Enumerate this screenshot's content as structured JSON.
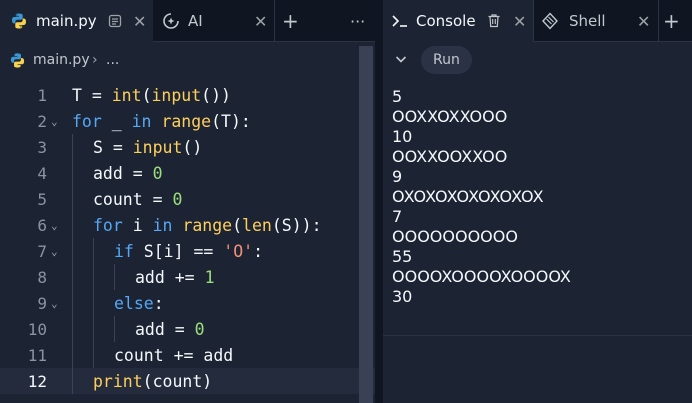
{
  "editor": {
    "tabs": [
      {
        "label": "main.py",
        "icon": "python-icon",
        "active": true
      },
      {
        "label": "AI",
        "icon": "ai-icon",
        "active": false
      }
    ],
    "breadcrumb": {
      "file": "main.py",
      "separator": "›",
      "ellipsis": "..."
    },
    "lines": [
      {
        "n": "1",
        "fold": false,
        "indent": 0,
        "tokens": [
          [
            "id",
            "T "
          ],
          [
            "op",
            "= "
          ],
          [
            "fn",
            "int"
          ],
          [
            "op",
            "("
          ],
          [
            "fn",
            "input"
          ],
          [
            "op",
            "())"
          ]
        ]
      },
      {
        "n": "2",
        "fold": true,
        "indent": 0,
        "tokens": [
          [
            "kw",
            "for"
          ],
          [
            "id",
            " _ "
          ],
          [
            "kw",
            "in"
          ],
          [
            "id",
            " "
          ],
          [
            "fn",
            "range"
          ],
          [
            "op",
            "(T):"
          ]
        ]
      },
      {
        "n": "3",
        "fold": false,
        "indent": 1,
        "tokens": [
          [
            "id",
            "S "
          ],
          [
            "op",
            "= "
          ],
          [
            "fn",
            "input"
          ],
          [
            "op",
            "()"
          ]
        ]
      },
      {
        "n": "4",
        "fold": false,
        "indent": 1,
        "tokens": [
          [
            "id",
            "add "
          ],
          [
            "op",
            "= "
          ],
          [
            "num",
            "0"
          ]
        ]
      },
      {
        "n": "5",
        "fold": false,
        "indent": 1,
        "tokens": [
          [
            "id",
            "count "
          ],
          [
            "op",
            "= "
          ],
          [
            "num",
            "0"
          ]
        ]
      },
      {
        "n": "6",
        "fold": true,
        "indent": 1,
        "tokens": [
          [
            "kw",
            "for"
          ],
          [
            "id",
            " i "
          ],
          [
            "kw",
            "in"
          ],
          [
            "id",
            " "
          ],
          [
            "fn",
            "range"
          ],
          [
            "op",
            "("
          ],
          [
            "fn",
            "len"
          ],
          [
            "op",
            "(S)):"
          ]
        ]
      },
      {
        "n": "7",
        "fold": true,
        "indent": 2,
        "tokens": [
          [
            "kw",
            "if"
          ],
          [
            "id",
            " S[i] "
          ],
          [
            "op",
            "== "
          ],
          [
            "str",
            "'O'"
          ],
          [
            "op",
            ":"
          ]
        ]
      },
      {
        "n": "8",
        "fold": false,
        "indent": 3,
        "tokens": [
          [
            "id",
            "add "
          ],
          [
            "op",
            "+= "
          ],
          [
            "num",
            "1"
          ]
        ]
      },
      {
        "n": "9",
        "fold": true,
        "indent": 2,
        "tokens": [
          [
            "kw",
            "else"
          ],
          [
            "op",
            ":"
          ]
        ]
      },
      {
        "n": "10",
        "fold": false,
        "indent": 3,
        "tokens": [
          [
            "id",
            "add "
          ],
          [
            "op",
            "= "
          ],
          [
            "num",
            "0"
          ]
        ]
      },
      {
        "n": "11",
        "fold": false,
        "indent": 2,
        "tokens": [
          [
            "id",
            "count "
          ],
          [
            "op",
            "+= "
          ],
          [
            "id",
            "add"
          ]
        ]
      },
      {
        "n": "12",
        "fold": false,
        "indent": 1,
        "current": true,
        "tokens": [
          [
            "fn",
            "print"
          ],
          [
            "op",
            "(count)"
          ]
        ]
      }
    ]
  },
  "console": {
    "tabs": [
      {
        "label": "Console",
        "icon": "terminal-icon",
        "active": true
      },
      {
        "label": "Shell",
        "icon": "shell-icon",
        "active": false
      }
    ],
    "run_label": "Run",
    "output": [
      "5",
      "OOXXOXXOOO",
      "10",
      "OOXXOOXXOO",
      "9",
      "OXOXOXOXOXOXOX",
      "7",
      "OOOOOOOOOO",
      "55",
      "OOOOXOOOOXOOOOX",
      "30"
    ]
  },
  "colors": {
    "bg": "#1c2333",
    "chrome": "#0f1521",
    "keyword": "#56a8f5",
    "function": "#ffcf5c",
    "number": "#9ce07b",
    "string": "#f48f76"
  }
}
